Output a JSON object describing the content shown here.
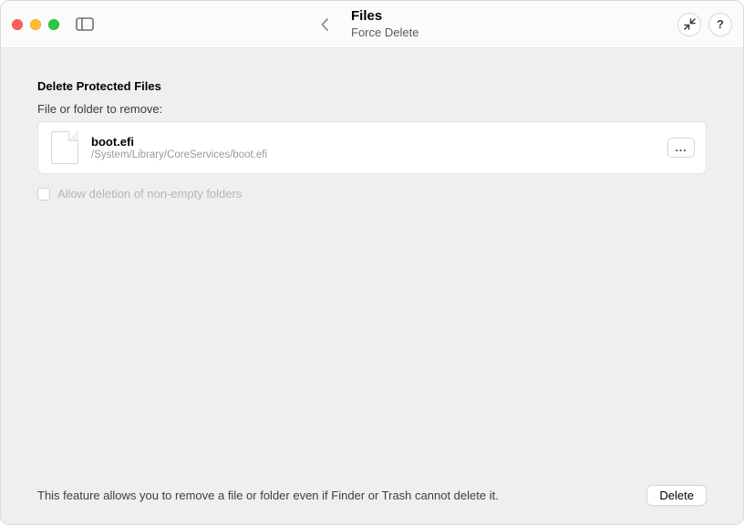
{
  "header": {
    "title": "Files",
    "subtitle": "Force Delete"
  },
  "section": {
    "title": "Delete Protected Files",
    "field_label": "File or folder to remove:"
  },
  "file": {
    "name": "boot.efi",
    "path": "/System/Library/CoreServices/boot.efi",
    "browse_label": "..."
  },
  "checkbox": {
    "label": "Allow deletion of non-empty folders",
    "checked": false,
    "enabled": false
  },
  "footer": {
    "hint": "This feature allows you to remove a file or folder even if Finder or Trash cannot delete it.",
    "action_label": "Delete"
  },
  "toolbar": {
    "help_glyph": "?"
  }
}
